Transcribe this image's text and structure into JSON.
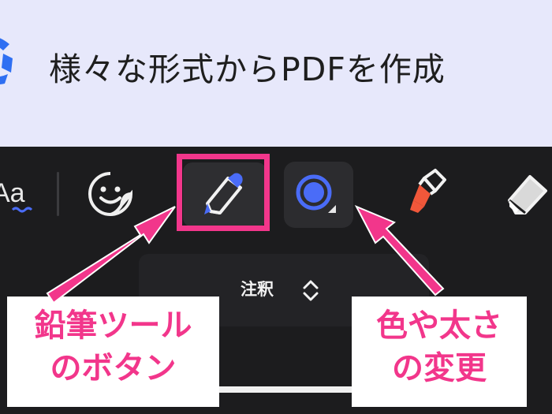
{
  "banner": {
    "title": "様々な形式からPDFを作成",
    "logo_icon": "brand-logo-icon"
  },
  "toolbar": {
    "tools": [
      {
        "name": "text-tool",
        "label": "Aa",
        "icon": "text-aa-icon"
      },
      {
        "name": "sticker-tool",
        "icon": "smiley-sticker-icon"
      },
      {
        "name": "pencil-tool",
        "icon": "pencil-icon",
        "selected": true
      },
      {
        "name": "color-width-tool",
        "icon": "color-circle-icon"
      },
      {
        "name": "highlighter-tool",
        "icon": "highlighter-icon"
      },
      {
        "name": "eraser-tool",
        "icon": "eraser-icon"
      }
    ]
  },
  "mode_selector": {
    "label": "注釈"
  },
  "callouts": {
    "pencil": {
      "line1": "鉛筆ツール",
      "line2": "のボタン"
    },
    "color": {
      "line1": "色や太さ",
      "line2": "の変更"
    }
  },
  "colors": {
    "accent_pink": "#f2368b",
    "pencil_blue": "#4a6cf7",
    "highlighter_red": "#f0573a",
    "toolbar_bg": "#1c1c1e",
    "banner_bg": "#e7e8fb"
  }
}
